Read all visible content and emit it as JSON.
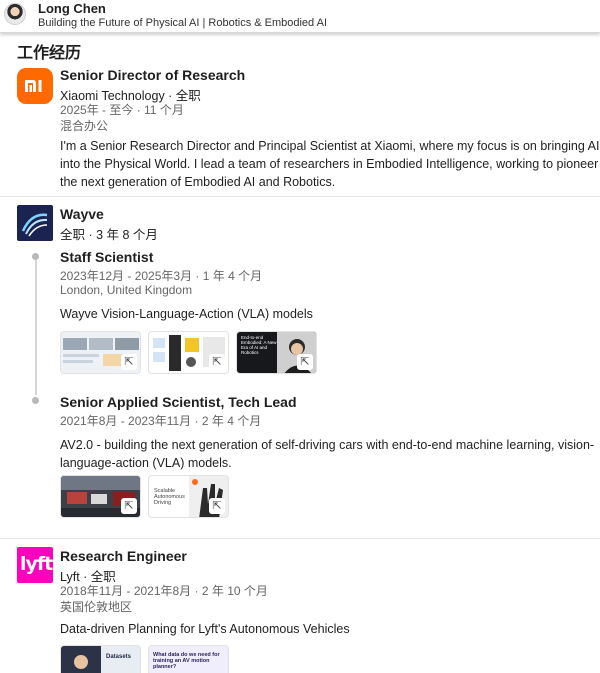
{
  "profile": {
    "name": "Long Chen",
    "headline": "Building the Future of Physical AI | Robotics & Embodied AI"
  },
  "section": {
    "title": "工作经历"
  },
  "experiences": [
    {
      "role": "Senior Director of Research",
      "company_line": "Xiaomi Technology · 全职",
      "dates": "2025年 - 至今 · 11 个月",
      "location": "混合办公",
      "description": "I'm a Senior Research Director and Principal Scientist at Xiaomi, where my focus is on bringing AI into the Physical World. I lead a team of researchers in Embodied Intelligence, working to pioneer the next generation of Embodied AI and Robotics."
    },
    {
      "company": "Wayve",
      "summary": "全职 · 3 年 8 个月",
      "positions": [
        {
          "role": "Staff Scientist",
          "dates": "2023年12月 - 2025年3月 · 1 年 4 个月",
          "location": "London, United Kingdom",
          "description": "Wayve Vision-Language-Action (VLA) models"
        },
        {
          "role": "Senior Applied Scientist, Tech Lead",
          "dates": "2021年8月 - 2023年11月 · 2 年 4 个月",
          "description": "AV2.0 - building the next generation of self-driving cars with end-to-end machine learning, vision-language-action (VLA) models."
        }
      ]
    },
    {
      "role": "Research Engineer",
      "company_line": "Lyft · 全职",
      "dates": "2018年11月 - 2021年8月 · 2 年 10 个月",
      "location": "英国伦敦地区",
      "description": "Data-driven Planning for Lyft's Autonomous Vehicles"
    }
  ],
  "media": {
    "wayve_ss": {
      "thumb3_text": "End-to-end Embodied: A New Era of AI and Robotics"
    },
    "wayve_sas": {
      "thumb2_text": "Scalable Autonomous Driving"
    },
    "lyft": {
      "thumb1_text": "Datasets",
      "thumb2_text": "What data do we need for training an AV motion planner?"
    }
  },
  "icons": {
    "external": "external-link-icon",
    "xiaomi_logo": "mi"
  },
  "colors": {
    "xiaomi": "#ff6900",
    "wayve": "#1b2350",
    "lyft": "#ff00bf"
  }
}
